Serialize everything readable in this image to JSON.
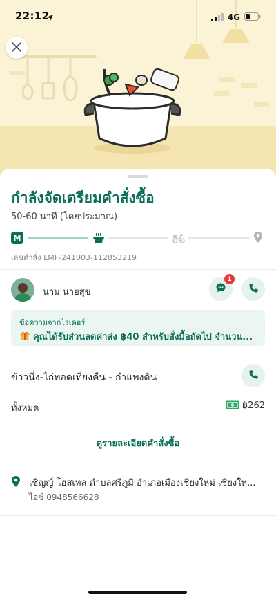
{
  "status_bar": {
    "time": "22:12",
    "network": "4G",
    "location_icon": "location-arrow-icon",
    "signal_icon": "signal-bars-icon",
    "battery_icon": "battery-icon"
  },
  "header": {
    "close_icon": "close-icon",
    "illustration": "cooking-pot-illustration"
  },
  "order": {
    "status_title": "กำลังจัดเตรียมคำสั่งซื้อ",
    "eta": "50-60 นาที (โดยประมาณ)",
    "order_number": "เลขคำสั่ง LMF-241003-112853219",
    "progress": {
      "steps": [
        "store-m-icon",
        "cooking-pot-icon",
        "scooter-icon",
        "destination-pin-icon"
      ],
      "current_step": 2
    }
  },
  "rider": {
    "name": "นาม นายสุข",
    "chat_unread": "1",
    "message_card": {
      "caption": "ข้อความจากไรเดอร์",
      "text": "คุณได้รับส่วนลดค่าส่ง ฿40 สำหรับสั่งมื้อถัดไป จำนวน...",
      "icon": "gift-icon"
    }
  },
  "restaurant": {
    "name": "ข้าวนึ่ง-ไก่ทอดเที่ยงคืน - กำแพงดิน",
    "total_label": "ทั้งหมด",
    "total_value": "฿262",
    "payment_icon": "cash-icon"
  },
  "details_link": "ดูรายละเอียดคำสั่งซื้อ",
  "delivery": {
    "address": "เชิญญ์ โฮสเทล ตำบลศรีภูมิ อำเภอเมืองเชียงใหม่ เชียงให...",
    "contact": "ไอซ์  0948566628"
  },
  "colors": {
    "brand": "#0b6e5a",
    "brand_light": "#e5f2ee",
    "progress_done": "#9ed3c8",
    "badge": "#e53935",
    "hero_bg": "#fbf3d6"
  }
}
